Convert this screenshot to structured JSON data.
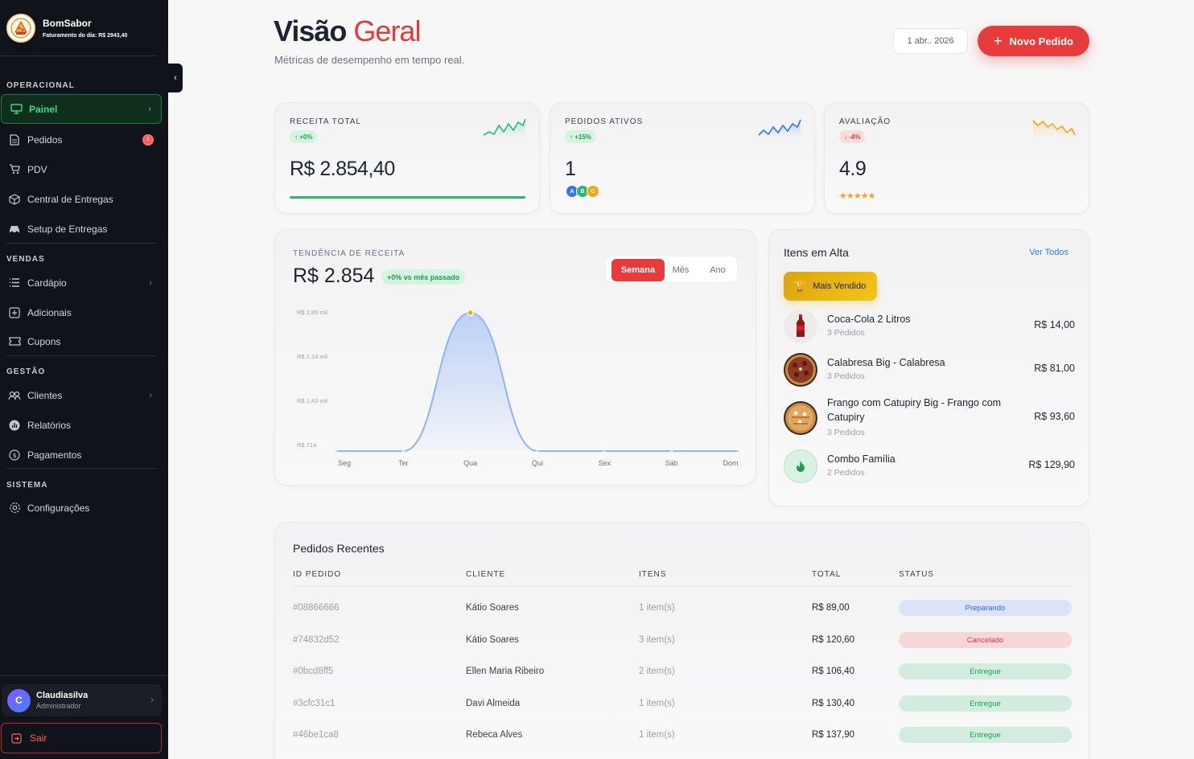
{
  "brand": {
    "name": "BomSabor",
    "subtitle": "Faturamento do dia: R$ 2943,40"
  },
  "sidebar": {
    "sections": {
      "operacional": "OPERACIONAL",
      "vendas": "VENDAS",
      "gestao": "GESTÃO",
      "sistema": "SISTEMA"
    },
    "items": [
      {
        "label": "Painel",
        "icon": "monitor-icon",
        "active": true
      },
      {
        "label": "Pedidos",
        "icon": "document-icon",
        "badge": "1"
      },
      {
        "label": "PDV",
        "icon": "cart-icon"
      },
      {
        "label": "Central de Entregas",
        "icon": "box-icon"
      },
      {
        "label": "Setup de Entregas",
        "icon": "car-icon"
      },
      {
        "label": "Cardápio",
        "icon": "list-icon"
      },
      {
        "label": "Adicionais",
        "icon": "add-square-icon"
      },
      {
        "label": "Cupons",
        "icon": "ticket-icon"
      },
      {
        "label": "Clientes",
        "icon": "users-icon"
      },
      {
        "label": "Relatórios",
        "icon": "chart-icon"
      },
      {
        "label": "Pagamentos",
        "icon": "dollar-icon"
      },
      {
        "label": "Configurações",
        "icon": "gear-icon"
      }
    ],
    "user": {
      "initial": "C",
      "name": "Claudiasilva",
      "role": "Administrador"
    },
    "logout": "Sair"
  },
  "header": {
    "title_main": "Visão",
    "title_accent": "Geral",
    "subtitle": "Métricas de desempenho em tempo real.",
    "date": "1 abr.. 2026",
    "new_order": "Novo Pedido"
  },
  "stats": {
    "revenue": {
      "label": "RECEITA TOTAL",
      "change": "↑ +0%",
      "value": "R$ 2.854,40",
      "color": "#2bb673"
    },
    "active_orders": {
      "label": "PEDIDOS ATIVOS",
      "change": "↑ +15%",
      "value": "1",
      "avatars": [
        "A",
        "B",
        "C"
      ],
      "color": "#3b74e8"
    },
    "rating": {
      "label": "AVALIAÇÃO",
      "change": "↓ -4%",
      "value": "4.9",
      "stars": "★★★★★",
      "color": "#f3a51d"
    }
  },
  "trend": {
    "label": "TENDÊNCIA DE RECEITA",
    "value": "R$ 2.854",
    "change": "+0% vs mês passado",
    "tabs": [
      "Semana",
      "Mês",
      "Ano"
    ],
    "active_tab": "Semana"
  },
  "chart_data": {
    "type": "area",
    "categories": [
      "Seg",
      "Ter",
      "Qua",
      "Qui",
      "Sex",
      "Sáb",
      "Dom"
    ],
    "values": [
      0,
      0,
      2854.4,
      0,
      0,
      0,
      0
    ],
    "yticks": [
      "R$ 2,85 mil",
      "R$ 2,14 mil",
      "R$ 1,43 mil",
      "R$ 714"
    ],
    "ylim": [
      0,
      2854.4
    ],
    "color": "#8fb4f5"
  },
  "trending": {
    "title": "Itens em Alta",
    "see_all": "Ver Todos",
    "badge": "Mais Vendido",
    "items": [
      {
        "name": "Coca-Cola 2 Litros",
        "orders": "3 Pedidos",
        "price": "R$ 14,00",
        "icon": "soda-bottle-icon"
      },
      {
        "name": "Calabresa Big - Calabresa",
        "orders": "3 Pedidos",
        "price": "R$ 81,00",
        "icon": "pizza-icon"
      },
      {
        "name": "Frango com Catupiry Big - Frango com Catupiry",
        "orders": "3 Pedidos",
        "price": "R$ 93,60",
        "icon": "pizza-icon"
      },
      {
        "name": "Combo Família",
        "orders": "2 Pedidos",
        "price": "R$ 129,90",
        "icon": "flame-icon"
      }
    ]
  },
  "orders": {
    "title": "Pedidos Recentes",
    "columns": [
      "ID PEDIDO",
      "CLIENTE",
      "ITENS",
      "TOTAL",
      "STATUS"
    ],
    "rows": [
      {
        "id": "#08866666",
        "client": "Kátio Soares",
        "items": "1 item(s)",
        "total": "R$ 89,00",
        "status": "Preparando"
      },
      {
        "id": "#74832d52",
        "client": "Kátio Soares",
        "items": "3 item(s)",
        "total": "R$ 120,60",
        "status": "Cancelado"
      },
      {
        "id": "#0bcd8ff5",
        "client": "Ellen Maria Ribeiro",
        "items": "2 item(s)",
        "total": "R$ 106,40",
        "status": "Entregue"
      },
      {
        "id": "#3cfc31c1",
        "client": "Davi Almeida",
        "items": "1 item(s)",
        "total": "R$ 130,40",
        "status": "Entregue"
      },
      {
        "id": "#46be1ca8",
        "client": "Rebeca Alves",
        "items": "1 item(s)",
        "total": "R$ 137,90",
        "status": "Entregue"
      }
    ]
  }
}
